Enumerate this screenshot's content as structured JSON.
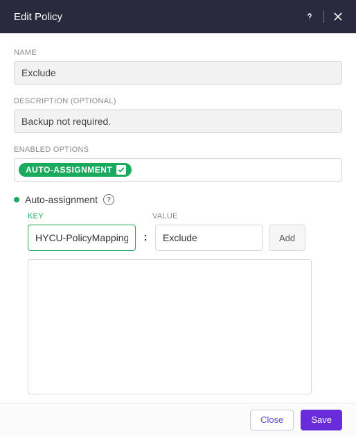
{
  "header": {
    "title": "Edit Policy"
  },
  "form": {
    "name_label": "NAME",
    "name_value": "Exclude",
    "description_label": "DESCRIPTION (OPTIONAL)",
    "description_value": "Backup not required.",
    "enabled_options_label": "ENABLED OPTIONS",
    "chip_label": "AUTO-ASSIGNMENT"
  },
  "autoassign": {
    "title": "Auto-assignment",
    "key_label": "KEY",
    "value_label": "VALUE",
    "key_value": "HYCU-PolicyMapping",
    "value_value": "Exclude",
    "add_label": "Add",
    "colon": ":"
  },
  "footer": {
    "close": "Close",
    "save": "Save"
  },
  "colors": {
    "accent_green": "#1aaa5d",
    "primary_purple": "#6a2bd9",
    "header_bg": "#2a2a3f"
  }
}
